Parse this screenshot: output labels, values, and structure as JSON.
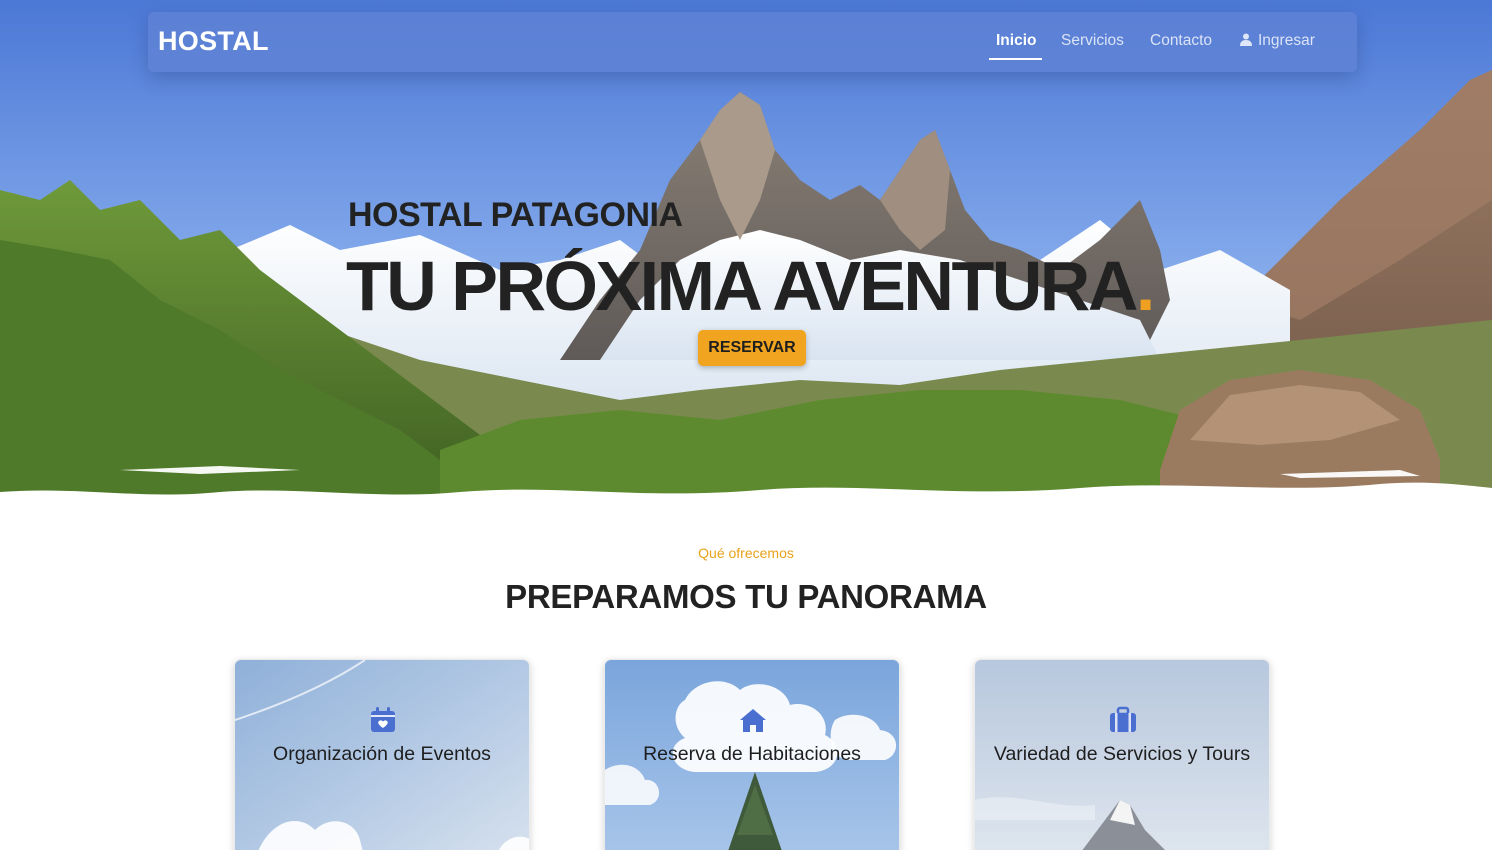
{
  "navbar": {
    "brand": "HOSTAL",
    "links": [
      {
        "label": "Inicio",
        "active": true
      },
      {
        "label": "Servicios",
        "active": false
      },
      {
        "label": "Contacto",
        "active": false
      },
      {
        "label": "Ingresar",
        "active": false,
        "icon": "user-icon"
      }
    ]
  },
  "hero": {
    "subtitle": "HOSTAL PATAGONIA",
    "title": "TU PRÓXIMA AVENTURA",
    "title_dot": ".",
    "button_label": "RESERVAR"
  },
  "services": {
    "eyebrow": "Qué ofrecemos",
    "title": "PREPARAMOS TU PANORAMA",
    "cards": [
      {
        "icon": "calendar-heart-icon",
        "title": "Organización de Eventos"
      },
      {
        "icon": "house-icon",
        "title": "Reserva de Habitaciones"
      },
      {
        "icon": "suitcase-icon",
        "title": "Variedad de Servicios y Tours"
      }
    ]
  },
  "colors": {
    "accent": "#f0a41f",
    "navbar": "#6082d4",
    "icon": "#4a6fd0",
    "text": "#222222"
  }
}
